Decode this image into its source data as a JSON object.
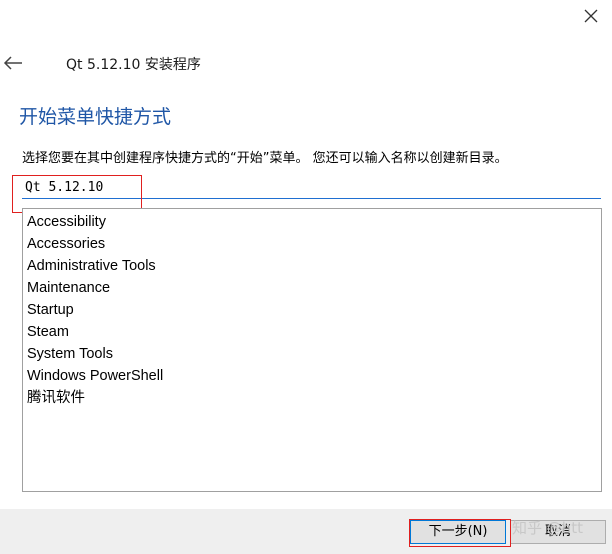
{
  "window": {
    "title": "Qt 5.12.10 安装程序",
    "close_icon": "close-icon",
    "back_icon": "back-arrow-icon"
  },
  "page": {
    "heading": "开始菜单快捷方式",
    "instruction": "选择您要在其中创建程序快捷方式的“开始”菜单。 您还可以输入名称以创建新目录。"
  },
  "folder_input": {
    "value": "Qt 5.12.10"
  },
  "folders": [
    "Accessibility",
    "Accessories",
    "Administrative Tools",
    "Maintenance",
    "Startup",
    "Steam",
    "System Tools",
    "Windows PowerShell",
    "腾讯软件"
  ],
  "buttons": {
    "next": "下一步(N)",
    "cancel": "取消"
  },
  "watermark": "知乎 @htt",
  "colors": {
    "heading": "#1f56a6",
    "highlight": "#e0201f",
    "input_underline": "#1f6fd1"
  }
}
